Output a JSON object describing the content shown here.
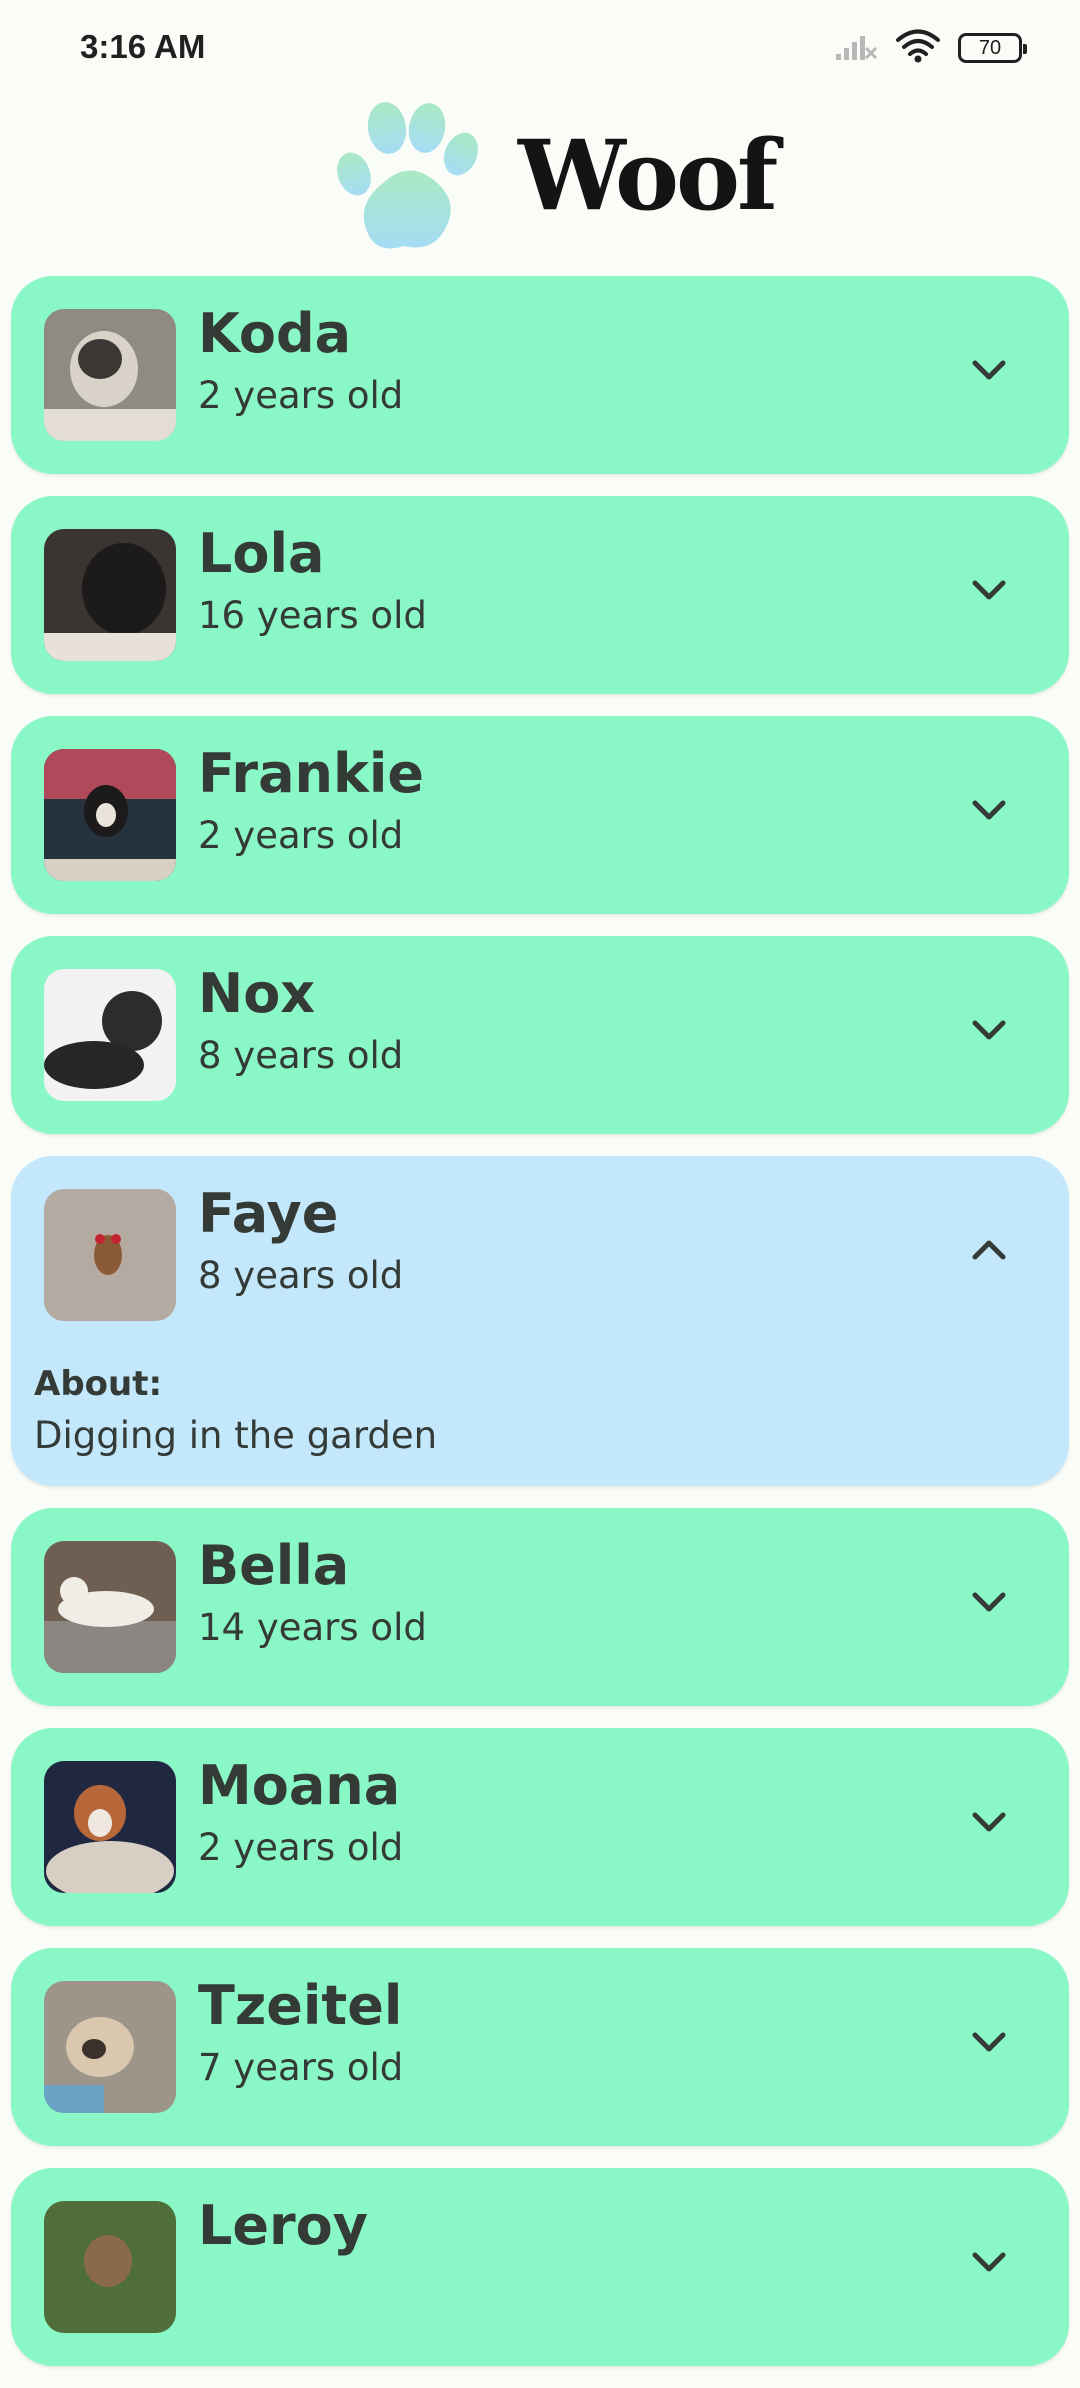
{
  "status_bar": {
    "time": "3:16 AM",
    "battery": "70",
    "icons": [
      "signal-icon",
      "wifi-icon",
      "battery-icon"
    ]
  },
  "app": {
    "title": "Woof",
    "logo_icon": "paw-icon"
  },
  "colors": {
    "card_collapsed": "#89f7c6",
    "card_expanded": "#c4e8fb",
    "text": "#343a36"
  },
  "dogs": [
    {
      "name": "Koda",
      "age": "2 years old",
      "expanded": false,
      "photo_bg": "#8f8a84"
    },
    {
      "name": "Lola",
      "age": "16 years old",
      "expanded": false,
      "photo_bg": "#2a2626"
    },
    {
      "name": "Frankie",
      "age": "2 years old",
      "expanded": false,
      "photo_bg": "#27323f"
    },
    {
      "name": "Nox",
      "age": "8 years old",
      "expanded": false,
      "photo_bg": "#3b3b3d"
    },
    {
      "name": "Faye",
      "age": "8 years old",
      "expanded": true,
      "about_label": "About:",
      "about_text": "Digging in the garden",
      "photo_bg": "#b4aaa1"
    },
    {
      "name": "Bella",
      "age": "14 years old",
      "expanded": false,
      "photo_bg": "#8b8178"
    },
    {
      "name": "Moana",
      "age": "2 years old",
      "expanded": false,
      "photo_bg": "#5b4b45"
    },
    {
      "name": "Tzeitel",
      "age": "7 years old",
      "expanded": false,
      "photo_bg": "#958a80"
    },
    {
      "name": "Leroy",
      "age": "",
      "expanded": false,
      "photo_bg": "#4f6e3a"
    }
  ]
}
